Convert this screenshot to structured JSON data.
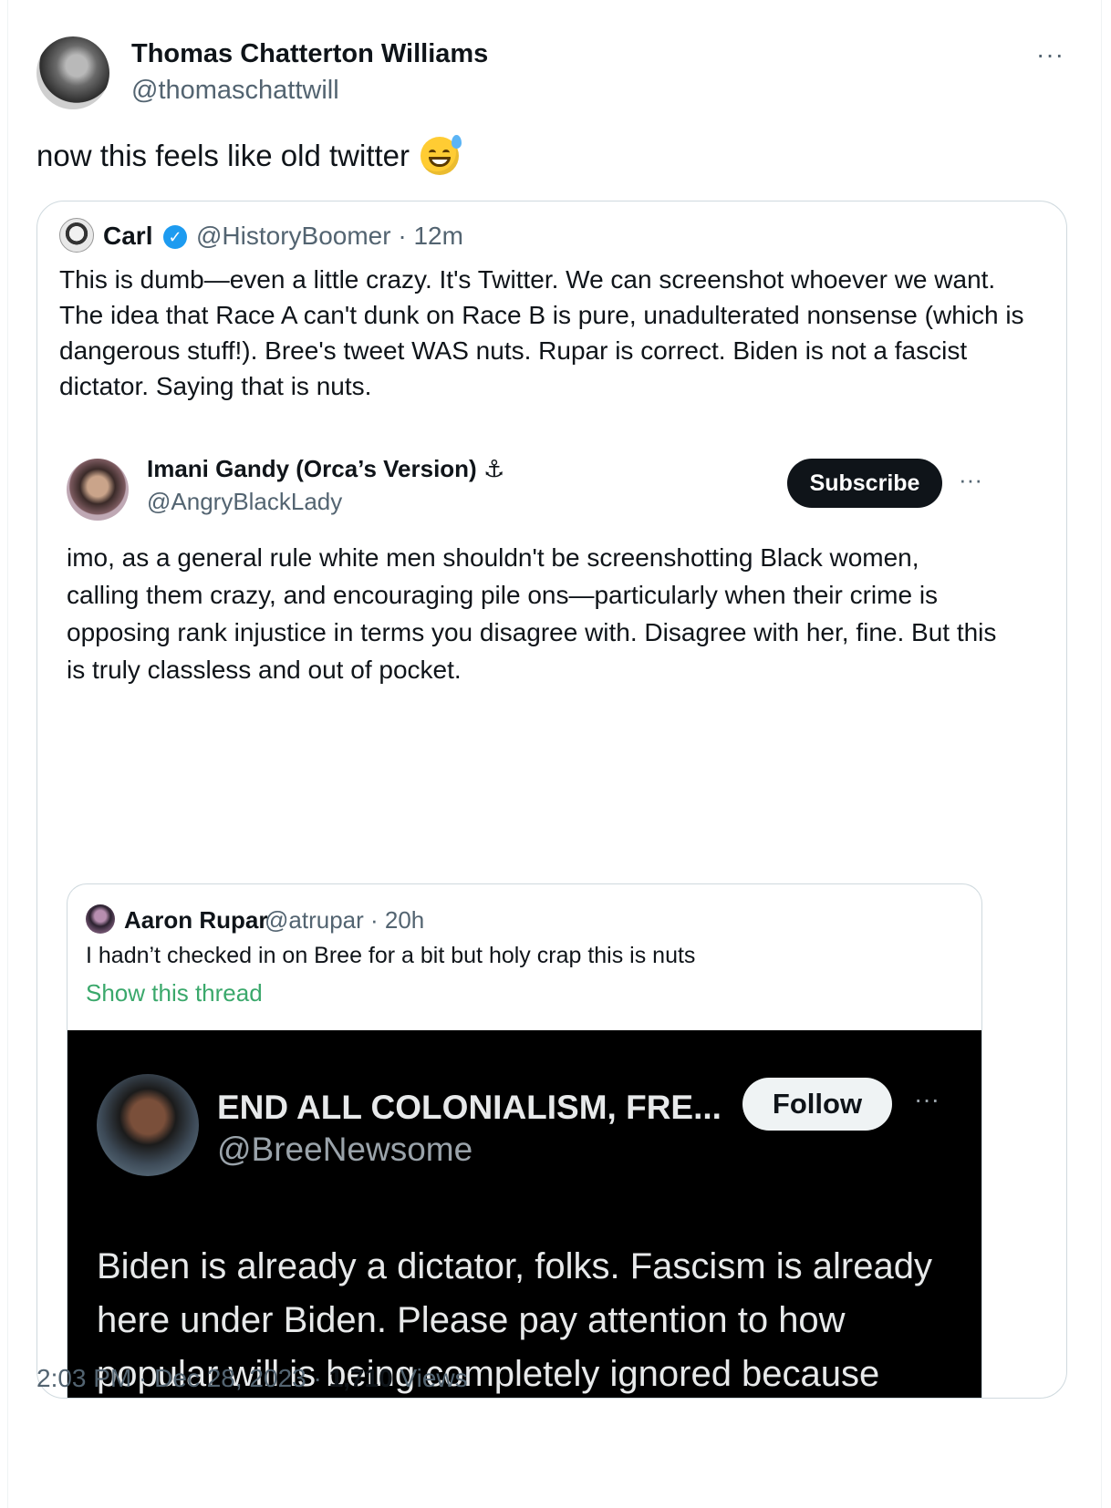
{
  "tweet": {
    "author_name": "Thomas Chatterton Williams",
    "author_handle": "@thomaschattwill",
    "more_label": "···",
    "text": "now this feels like old twitter",
    "emoji_icon": "grinning-face-with-sweat-icon",
    "time": "2:03 PM · Dec 28, 2023 · ",
    "views_count": "1,710",
    "views_label": " Views"
  },
  "quote": {
    "name": "Carl",
    "verified_icon": "verified-badge-icon",
    "verified_glyph": "✓",
    "meta": "@HistoryBoomer · 12m",
    "text": "This is dumb—even a little crazy. It's Twitter. We can screenshot whoever we want. The idea that Race A can't dunk on Race B is pure, unadulterated nonsense (which is dangerous stuff!). Bree's tweet WAS nuts. Rupar is correct. Biden is not a fascist dictator. Saying that is nuts."
  },
  "imani": {
    "name": "Imani Gandy (Orca’s Version) ⚓",
    "handle": "@AngryBlackLady",
    "subscribe_label": "Subscribe",
    "more_label": "···",
    "text": "imo, as a general rule white men shouldn't be screenshotting Black women, calling them crazy, and encouraging pile ons—particularly when their crime is opposing rank injustice in terms you disagree with. Disagree with her, fine. But this is truly classless and out of pocket."
  },
  "rupar": {
    "name": "Aaron Rupar",
    "meta": "@atrupar · 20h",
    "text": "I hadn’t checked in on Bree for a bit but holy crap this is nuts",
    "link": "Show this thread"
  },
  "bree": {
    "name": "END ALL COLONIALISM, FRE...",
    "handle": "@BreeNewsome",
    "follow_label": "Follow",
    "more_label": "···",
    "text": "Biden is already a dictator, folks. Fascism is already here under Biden. Please pay attention to how popular will is being completely ignored because Biden doesn’t give af what the public thinks if he can maintain his grip on power."
  }
}
